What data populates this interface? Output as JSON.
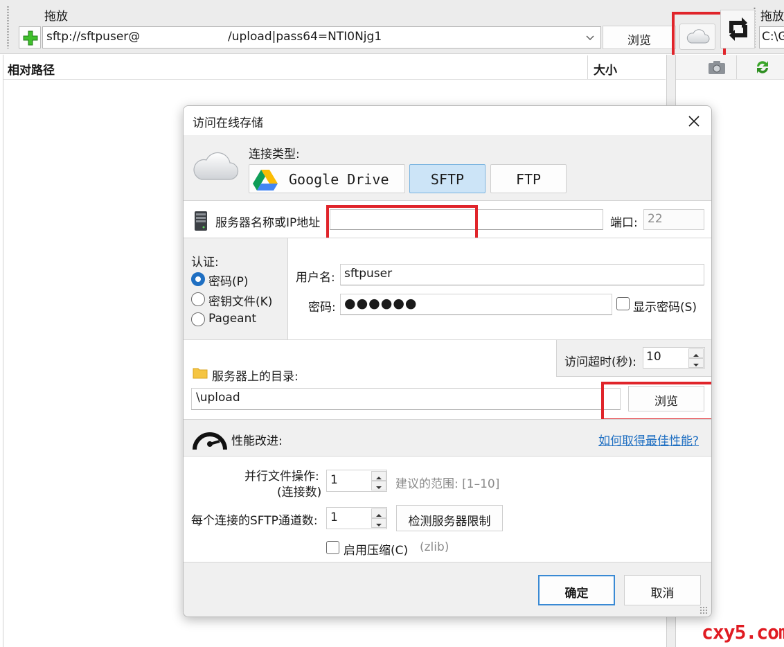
{
  "toolbar": {
    "drag_label_left": "拖放",
    "drag_label_right": "拖放",
    "path_prefix": "sftp://sftpuser@",
    "path_suffix": "/upload|pass64=NTI0Njg1",
    "browse_label": "浏览",
    "right_path_value": "C:\\G"
  },
  "list": {
    "col_path": "相对路径",
    "col_size": "大小"
  },
  "dialog": {
    "title": "访问在线存储",
    "connection_type_label": "连接类型:",
    "types": [
      {
        "label": "Google Drive"
      },
      {
        "label": "SFTP",
        "selected": true
      },
      {
        "label": "FTP"
      }
    ],
    "server_label": "服务器名称或IP地址",
    "server_value": "",
    "port_label": "端口:",
    "port_value": "22",
    "auth_label": "认证:",
    "auth_options": [
      {
        "label": "密码(P)",
        "checked": true
      },
      {
        "label": "密钥文件(K)",
        "checked": false
      },
      {
        "label": "Pageant",
        "checked": false
      }
    ],
    "username_label": "用户名:",
    "username_value": "sftpuser",
    "password_label": "密码:",
    "password_mask": "●●●●●●",
    "show_password_label": "显示密码(S)",
    "timeout_label": "访问超时(秒):",
    "timeout_value": "10",
    "dir_label": "服务器上的目录:",
    "dir_value": "\\upload",
    "dir_browse_label": "浏览",
    "perf_label": "性能改进:",
    "perf_link": "如何取得最佳性能?",
    "parallel_label_line1": "并行文件操作:",
    "parallel_label_line2": "(连接数)",
    "parallel_value": "1",
    "parallel_hint": "建议的范围: [1–10]",
    "channels_label": "每个连接的SFTP通道数:",
    "channels_value": "1",
    "detect_label": "检测服务器限制",
    "compress_label": "启用压缩(C)",
    "compress_hint": "(zlib)",
    "ok_label": "确定",
    "cancel_label": "取消"
  },
  "watermark": "cxy5.com",
  "colors": {
    "accent": "#1f6fc2",
    "annotation_red": "#e0242a",
    "selected_toggle": "#cce4f7"
  }
}
